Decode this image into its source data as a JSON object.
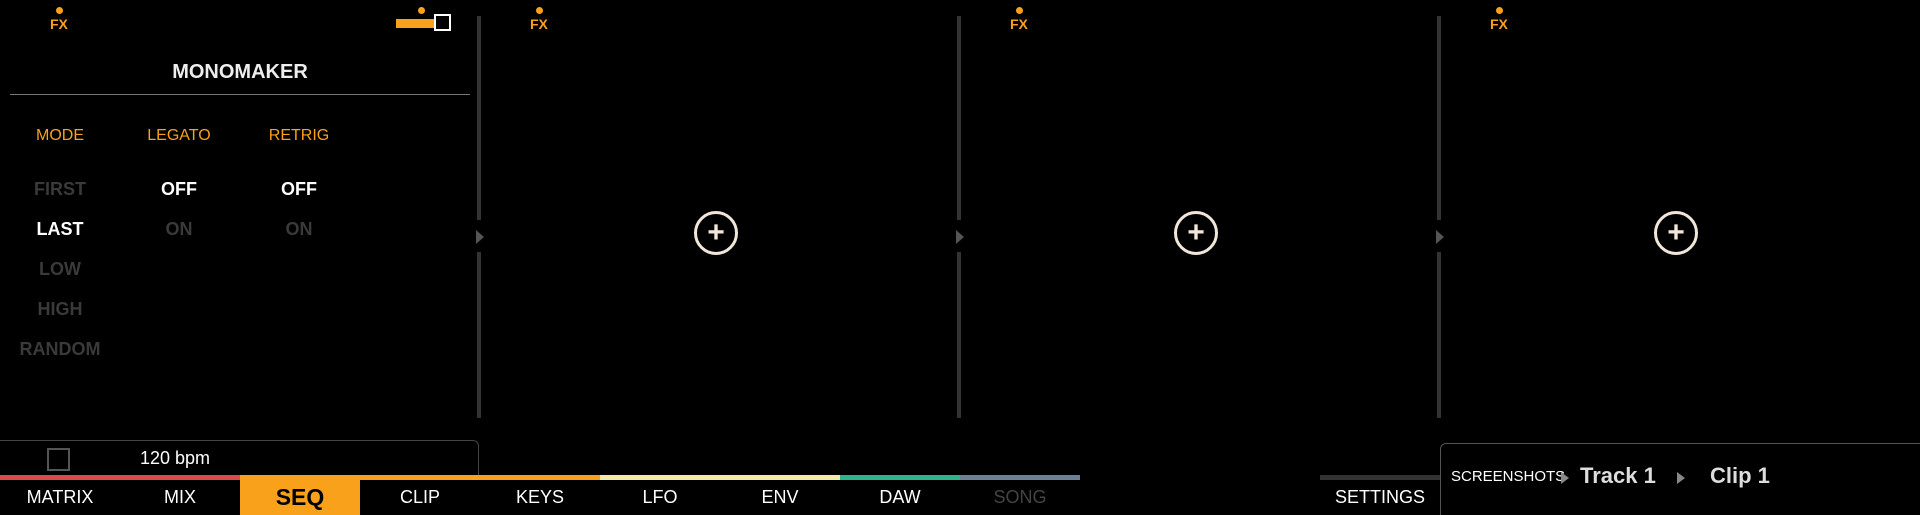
{
  "device": {
    "name": "MONOMAKER",
    "fx_label": "FX",
    "columns": [
      {
        "header": "MODE",
        "options": [
          "FIRST",
          "LAST",
          "LOW",
          "HIGH",
          "RANDOM"
        ],
        "selected": "LAST"
      },
      {
        "header": "LEGATO",
        "options": [
          "OFF",
          "ON"
        ],
        "selected": "OFF"
      },
      {
        "header": "RETRIG",
        "options": [
          "OFF",
          "ON"
        ],
        "selected": "OFF"
      }
    ],
    "level": 0.85
  },
  "slots": [
    {
      "fx_label": "FX",
      "add_icon": "+"
    },
    {
      "fx_label": "FX",
      "add_icon": "+"
    },
    {
      "fx_label": "FX",
      "add_icon": "+"
    }
  ],
  "footer": {
    "bpm": "120 bpm"
  },
  "nav": {
    "items": [
      "MATRIX",
      "MIX",
      "SEQ",
      "CLIP",
      "KEYS",
      "LFO",
      "ENV",
      "DAW",
      "SONG"
    ],
    "active": "SEQ",
    "disabled": [
      "SONG"
    ],
    "settings": "SETTINGS",
    "colors": [
      "#d94b4b",
      "#d94b4b",
      "#f9a11b",
      "#f9a11b",
      "#f9a11b",
      "#f5e9a8",
      "#2fb38a",
      "#2fb38a",
      "#6b7f95"
    ]
  },
  "breadcrumb": {
    "root": "SCREENSHOTS",
    "track": "Track 1",
    "clip": "Clip 1"
  },
  "colors": {
    "accent": "#f9a11b",
    "background": "#000000"
  }
}
